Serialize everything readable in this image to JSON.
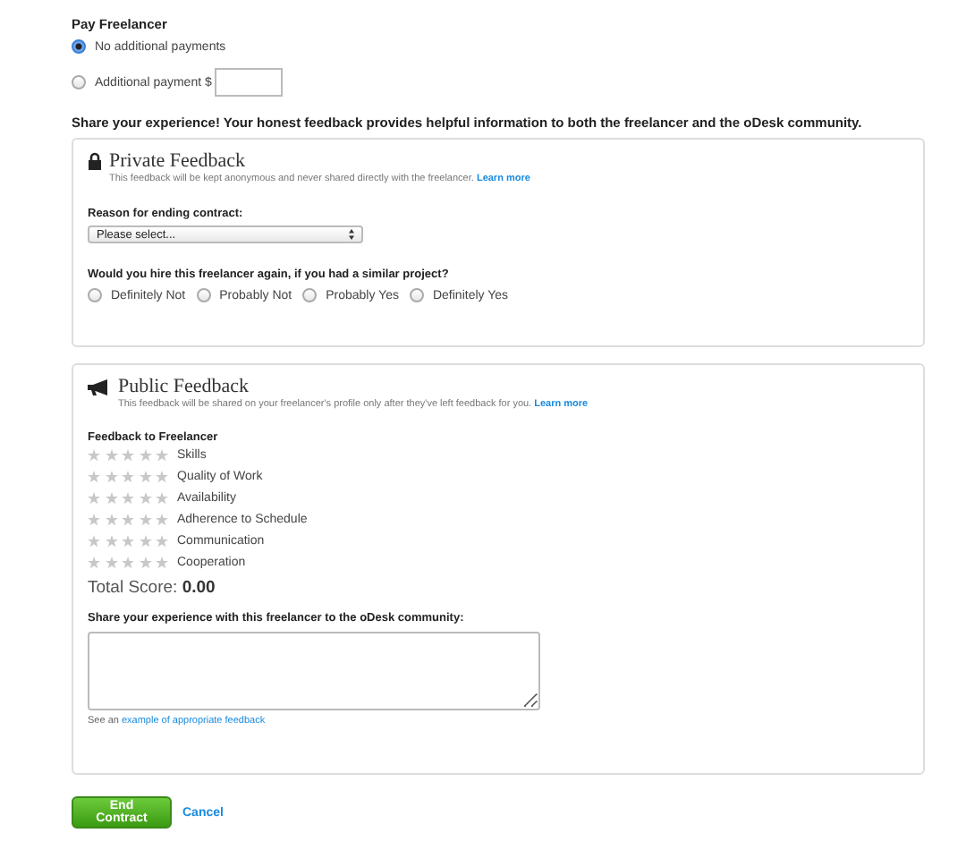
{
  "pay": {
    "title": "Pay Freelancer",
    "options": [
      {
        "label": "No additional payments",
        "selected": true,
        "kind": "plain"
      },
      {
        "label": "Additional payment $",
        "selected": false,
        "kind": "amount"
      }
    ]
  },
  "intro": "Share your experience! Your honest feedback provides helpful information to both the freelancer and the oDesk community.",
  "private": {
    "title": "Private Feedback",
    "note": "This feedback will be kept anonymous and never shared directly with the freelancer.",
    "link": "Learn more",
    "reason_label": "Reason for ending contract:",
    "reason_value": "Please select...",
    "question": "Would you hire this freelancer again, if you had a similar project?",
    "answers": [
      {
        "label": "Definitely Not",
        "selected": false
      },
      {
        "label": "Probably Not",
        "selected": false
      },
      {
        "label": "Probably Yes",
        "selected": false
      },
      {
        "label": "Definitely Yes",
        "selected": false
      }
    ]
  },
  "public": {
    "title": "Public Feedback",
    "note": "This feedback will be shared on your freelancer's profile only after they've left feedback for you.",
    "link": "Learn more",
    "ratings_title": "Feedback to Freelancer",
    "ratings": [
      {
        "label": "Skills",
        "stars": 0
      },
      {
        "label": "Quality of Work",
        "stars": 0
      },
      {
        "label": "Availability",
        "stars": 0
      },
      {
        "label": "Adherence to Schedule",
        "stars": 0
      },
      {
        "label": "Communication",
        "stars": 0
      },
      {
        "label": "Cooperation",
        "stars": 0
      }
    ],
    "total_label": "Total Score:",
    "total_value": "0.00",
    "share_label": "Share your experience with this freelancer to the oDesk community:",
    "hint": "See an",
    "hint_link": "example of appropriate feedback"
  },
  "actions": {
    "submit": "End Contract",
    "cancel": "Cancel"
  }
}
